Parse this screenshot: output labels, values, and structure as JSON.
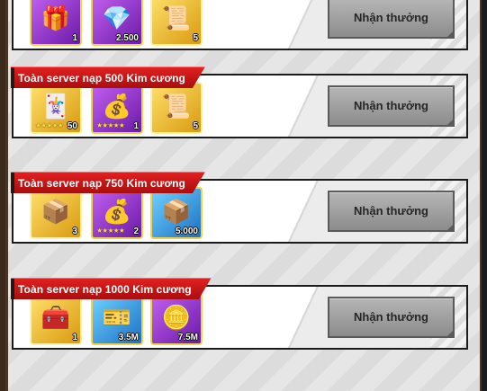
{
  "colors": {
    "title_red": "#d21a1a",
    "button_gray": "#a0a0a0",
    "frame": "#3a2a1e"
  },
  "rows": [
    {
      "title": "",
      "button_label": "Nhận thưởng",
      "items": [
        {
          "rarity": "purple",
          "icon": "crate-icon",
          "glyph": "🎁",
          "count": "1",
          "stars": ""
        },
        {
          "rarity": "purple",
          "icon": "gem-icon",
          "glyph": "💎",
          "count": "2.500",
          "stars": ""
        },
        {
          "rarity": "gold",
          "icon": "wanted-poster-icon",
          "glyph": "📜",
          "count": "5",
          "stars": ""
        }
      ]
    },
    {
      "title": "Toàn server nạp 500 Kim cương",
      "button_label": "Nhận thưởng",
      "items": [
        {
          "rarity": "gold",
          "icon": "cards-icon",
          "glyph": "🃏",
          "count": "50",
          "stars": "★★★★★"
        },
        {
          "rarity": "purple",
          "icon": "treasure-chest-icon",
          "glyph": "💰",
          "count": "1",
          "stars": "★★★★★"
        },
        {
          "rarity": "gold",
          "icon": "wanted-poster-icon",
          "glyph": "📜",
          "count": "5",
          "stars": ""
        }
      ]
    },
    {
      "title": "Toàn server nạp 750 Kim cương",
      "button_label": "Nhận thưởng",
      "items": [
        {
          "rarity": "gold",
          "icon": "green-box-icon",
          "glyph": "📦",
          "count": "3",
          "stars": ""
        },
        {
          "rarity": "purple",
          "icon": "treasure-chest-icon",
          "glyph": "💰",
          "count": "2",
          "stars": "★★★★★"
        },
        {
          "rarity": "blue",
          "icon": "wooden-crate-icon",
          "glyph": "📦",
          "count": "5.000",
          "stars": ""
        }
      ]
    },
    {
      "title": "Toàn server nạp 1000 Kim cương",
      "button_label": "Nhận thưởng",
      "items": [
        {
          "rarity": "gold",
          "icon": "chest-icon",
          "glyph": "🧰",
          "count": "1",
          "stars": ""
        },
        {
          "rarity": "blue",
          "icon": "exp-ticket-icon",
          "glyph": "🎫",
          "count": "3.5M",
          "stars": ""
        },
        {
          "rarity": "purple",
          "icon": "coin-icon",
          "glyph": "🪙",
          "count": "7.5M",
          "stars": ""
        }
      ]
    }
  ]
}
